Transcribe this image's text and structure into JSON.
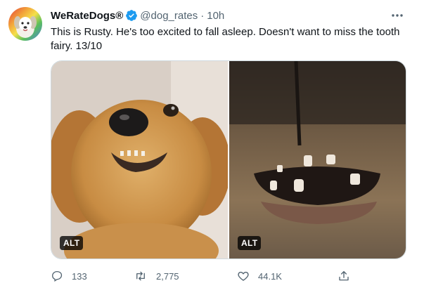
{
  "author": {
    "display_name": "WeRateDogs®",
    "handle": "@dog_rates",
    "separator": "·",
    "time": "10h"
  },
  "tweet": {
    "text": "This is Rusty. He's too excited to fall asleep. Doesn't want to miss the tooth fairy. 13/10"
  },
  "media": [
    {
      "alt_badge": "ALT"
    },
    {
      "alt_badge": "ALT"
    }
  ],
  "actions": {
    "reply_count": "133",
    "retweet_count": "2,775",
    "like_count": "44.1K"
  },
  "icons": {
    "verified": "verified-badge-icon",
    "more": "more-dots-icon",
    "reply": "reply-icon",
    "retweet": "retweet-icon",
    "like": "heart-icon",
    "share": "share-icon"
  },
  "colors": {
    "verified_blue": "#1d9bf0",
    "secondary_text": "#536471"
  }
}
